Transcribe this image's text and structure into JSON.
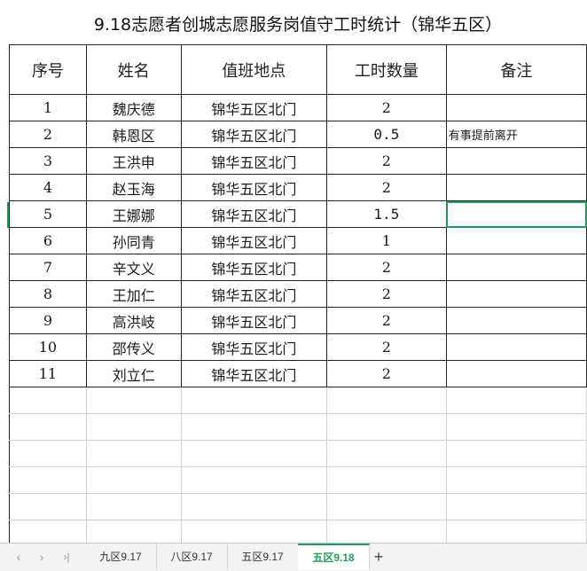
{
  "sheet": {
    "title": "9.18志愿者创城志愿服务岗值守工时统计（锦华五区）",
    "headers": [
      "序号",
      "姓名",
      "值班地点",
      "工时数量",
      "备注"
    ],
    "rows": [
      {
        "no": "1",
        "name": "魏庆德",
        "place": "锦华五区北门",
        "hours": "2",
        "note": ""
      },
      {
        "no": "2",
        "name": "韩恩区",
        "place": "锦华五区北门",
        "hours": "0.5",
        "note": "有事提前离开"
      },
      {
        "no": "3",
        "name": "王洪申",
        "place": "锦华五区北门",
        "hours": "2",
        "note": ""
      },
      {
        "no": "4",
        "name": "赵玉海",
        "place": "锦华五区北门",
        "hours": "2",
        "note": ""
      },
      {
        "no": "5",
        "name": "王娜娜",
        "place": "锦华五区北门",
        "hours": "1.5",
        "note": ""
      },
      {
        "no": "6",
        "name": "孙同青",
        "place": "锦华五区北门",
        "hours": "1",
        "note": ""
      },
      {
        "no": "7",
        "name": "辛文义",
        "place": "锦华五区北门",
        "hours": "2",
        "note": ""
      },
      {
        "no": "8",
        "name": "王加仁",
        "place": "锦华五区北门",
        "hours": "2",
        "note": ""
      },
      {
        "no": "9",
        "name": "高洪岐",
        "place": "锦华五区北门",
        "hours": "2",
        "note": ""
      },
      {
        "no": "10",
        "name": "邵传义",
        "place": "锦华五区北门",
        "hours": "2",
        "note": ""
      },
      {
        "no": "11",
        "name": "刘立仁",
        "place": "锦华五区北门",
        "hours": "2",
        "note": ""
      }
    ]
  },
  "tabs": {
    "nav_icons": [
      "chevron-left-icon",
      "chevron-right-icon",
      "last-page-icon"
    ],
    "nav_glyphs": [
      "‹",
      "›",
      "›|"
    ],
    "items": [
      "九区9.17",
      "八区9.17",
      "五区9.17",
      "五区9.18"
    ],
    "active": "五区9.18",
    "add_label": "+"
  },
  "colors": {
    "accent": "#1f9e5a",
    "grid": "#222222",
    "tabbar": "#f3f3f3"
  }
}
